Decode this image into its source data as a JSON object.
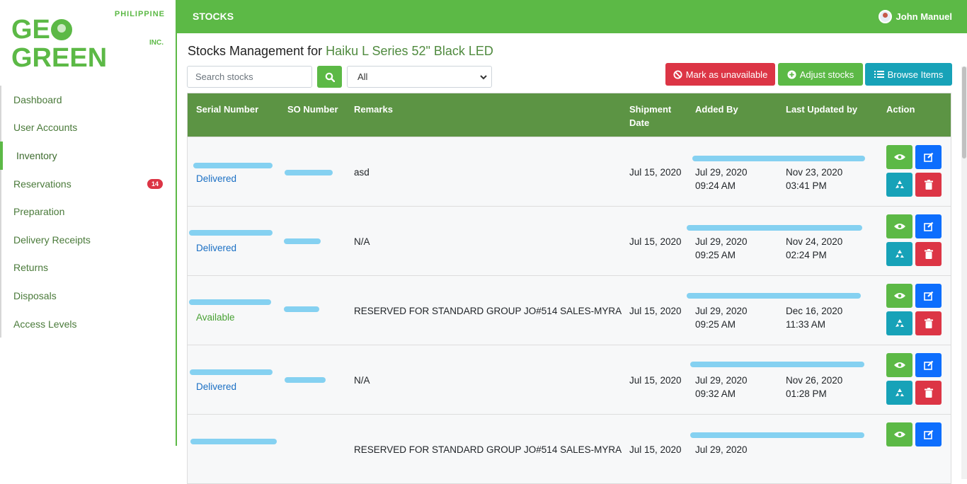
{
  "logo": {
    "top": "PHILIPPINE",
    "main": "GEOGREEN",
    "inc": "INC."
  },
  "sidebar": {
    "items": [
      {
        "label": "Dashboard"
      },
      {
        "label": "User Accounts"
      },
      {
        "label": "Inventory",
        "active": true
      },
      {
        "label": "Reservations",
        "badge": "14"
      },
      {
        "label": "Preparation"
      },
      {
        "label": "Delivery Receipts"
      },
      {
        "label": "Returns"
      },
      {
        "label": "Disposals"
      },
      {
        "label": "Access Levels"
      }
    ]
  },
  "topbar": {
    "title": "STOCKS",
    "user": "John Manuel"
  },
  "heading": {
    "prefix": "Stocks Management for ",
    "product": "Haiku L Series 52\" Black LED"
  },
  "controls": {
    "search_placeholder": "Search stocks",
    "filter_value": "All",
    "mark_unavailable": "Mark as unavailable",
    "adjust_stocks": "Adjust stocks",
    "browse_items": "Browse Items"
  },
  "table": {
    "headers": [
      "Serial Number",
      "SO Number",
      "Remarks",
      "Shipment Date",
      "Added By",
      "Last Updated by",
      "Action"
    ],
    "rows": [
      {
        "status": "Delivered",
        "remarks": "asd",
        "shipment": "Jul 15, 2020",
        "added_date": "Jul 29, 2020",
        "added_time": "09:24 AM",
        "updated_date": "Nov 23, 2020",
        "updated_time": "03:41 PM"
      },
      {
        "status": "Delivered",
        "remarks": "N/A",
        "shipment": "Jul 15, 2020",
        "added_date": "Jul 29, 2020",
        "added_time": "09:25 AM",
        "updated_date": "Nov 24, 2020",
        "updated_time": "02:24 PM"
      },
      {
        "status": "Available",
        "remarks": "RESERVED FOR STANDARD GROUP JO#514 SALES-MYRA",
        "shipment": "Jul 15, 2020",
        "added_date": "Jul 29, 2020",
        "added_time": "09:25 AM",
        "updated_date": "Dec 16, 2020",
        "updated_time": "11:33 AM"
      },
      {
        "status": "Delivered",
        "remarks": "N/A",
        "shipment": "Jul 15, 2020",
        "added_date": "Jul 29, 2020",
        "added_time": "09:32 AM",
        "updated_date": "Nov 26, 2020",
        "updated_time": "01:28 PM"
      },
      {
        "status": "",
        "remarks": "RESERVED FOR STANDARD GROUP JO#514 SALES-MYRA",
        "shipment": "Jul 15, 2020",
        "added_date": "Jul 29, 2020",
        "added_time": "",
        "updated_date": "",
        "updated_time": ""
      }
    ]
  },
  "colors": {
    "brand_green": "#5cb946",
    "header_green": "#5c9444",
    "danger": "#dc3545",
    "info": "#17a2b8",
    "primary": "#0d6efd"
  }
}
